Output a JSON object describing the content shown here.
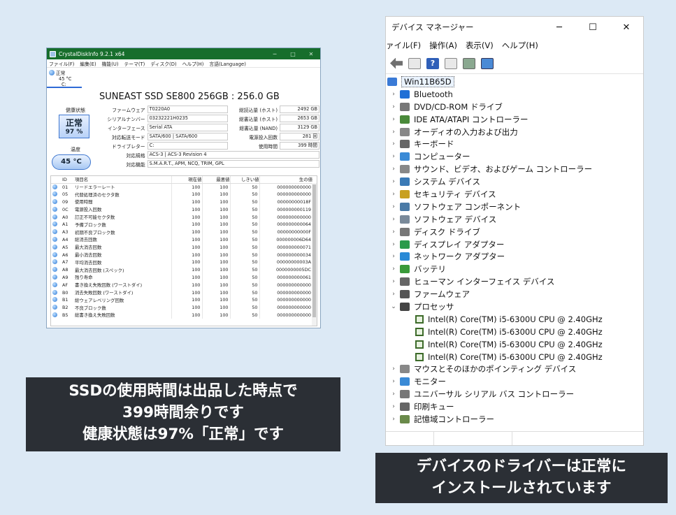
{
  "cdi": {
    "title": "CrystalDiskInfo 9.2.1 x64",
    "menu": [
      "ファイル(F)",
      "編集(E)",
      "機能(U)",
      "テーマ(T)",
      "ディスク(D)",
      "ヘルプ(H)",
      "言語(Language)"
    ],
    "disk_tab": {
      "status": "正常",
      "temp": "45 °C",
      "drive": "C:"
    },
    "disk_name": "SUNEAST SSD SE800 256GB : 256.0 GB",
    "health_label": "健康状態",
    "health_status": "正常",
    "health_percent": "97 %",
    "temp_label": "温度",
    "temp_value": "45 °C",
    "info_left": [
      {
        "label": "ファームウェア",
        "value": "T0220A0"
      },
      {
        "label": "シリアルナンバー",
        "value": "03232221H0235"
      },
      {
        "label": "インターフェース",
        "value": "Serial ATA"
      },
      {
        "label": "対応転送モード",
        "value": "SATA/600 | SATA/600"
      },
      {
        "label": "ドライブレター",
        "value": "C:"
      }
    ],
    "info_right": [
      {
        "label": "総読込量 (ホスト)",
        "value": "2492 GB"
      },
      {
        "label": "総書込量 (ホスト)",
        "value": "2653 GB"
      },
      {
        "label": "総書込量 (NAND)",
        "value": "3129 GB"
      },
      {
        "label": "電源投入回数",
        "value": "281 回"
      },
      {
        "label": "使用時間",
        "value": "399 時間"
      }
    ],
    "standard_label": "対応規格",
    "standard_value": "ACS-3 | ACS-3 Revision 4",
    "features_label": "対応機能",
    "features_value": "S.M.A.R.T., APM, NCQ, TRIM, GPL",
    "smart_headers": [
      "ID",
      "項目名",
      "現在値",
      "最悪値",
      "しきい値",
      "生の値"
    ],
    "smart_rows": [
      [
        "01",
        "リードエラーレート",
        "100",
        "100",
        "50",
        "000000000000"
      ],
      [
        "05",
        "代替処理済のセクタ数",
        "100",
        "100",
        "50",
        "000000000000"
      ],
      [
        "09",
        "使用時間",
        "100",
        "100",
        "50",
        "00000000018F"
      ],
      [
        "0C",
        "電源投入回数",
        "100",
        "100",
        "50",
        "000000000119"
      ],
      [
        "A0",
        "訂正不可能セクタ数",
        "100",
        "100",
        "50",
        "000000000000"
      ],
      [
        "A1",
        "予備ブロック数",
        "100",
        "100",
        "50",
        "000000000064"
      ],
      [
        "A3",
        "初期不良ブロック数",
        "100",
        "100",
        "50",
        "00000000000F"
      ],
      [
        "A4",
        "総消去回数",
        "100",
        "100",
        "50",
        "000000006D64"
      ],
      [
        "A5",
        "最大消去回数",
        "100",
        "100",
        "50",
        "000000000071"
      ],
      [
        "A6",
        "最小消去回数",
        "100",
        "100",
        "50",
        "000000000034"
      ],
      [
        "A7",
        "平均消去回数",
        "100",
        "100",
        "50",
        "00000000003A"
      ],
      [
        "A8",
        "最大消去回数 (スペック)",
        "100",
        "100",
        "50",
        "0000000005DC"
      ],
      [
        "A9",
        "残り寿命",
        "100",
        "100",
        "50",
        "000000000061"
      ],
      [
        "AF",
        "書き換え失敗回数 (ワーストダイ)",
        "100",
        "100",
        "50",
        "000000000000"
      ],
      [
        "B0",
        "消去失敗回数 (ワーストダイ)",
        "100",
        "100",
        "50",
        "000000000000"
      ],
      [
        "B1",
        "総ウェアレベリング回数",
        "100",
        "100",
        "50",
        "000000000000"
      ],
      [
        "B2",
        "不良ブロック数",
        "100",
        "100",
        "50",
        "000000000000"
      ],
      [
        "B5",
        "総書き換え失敗回数",
        "100",
        "100",
        "50",
        "000000000000"
      ]
    ]
  },
  "dm": {
    "title": "デバイス マネージャー",
    "menu": [
      "ァイル(F)",
      "操作(A)",
      "表示(V)",
      "ヘルプ(H)"
    ],
    "root": "Win11B65D",
    "categories": [
      {
        "label": "Bluetooth",
        "color": "#1f6fd6"
      },
      {
        "label": "DVD/CD-ROM ドライブ",
        "color": "#777777"
      },
      {
        "label": "IDE ATA/ATAPI コントローラー",
        "color": "#4a8a3a"
      },
      {
        "label": "オーディオの入力および出力",
        "color": "#888888"
      },
      {
        "label": "キーボード",
        "color": "#666666"
      },
      {
        "label": "コンピューター",
        "color": "#3a8ad6"
      },
      {
        "label": "サウンド、ビデオ、およびゲーム コントローラー",
        "color": "#888888"
      },
      {
        "label": "システム デバイス",
        "color": "#3a7ab6"
      },
      {
        "label": "セキュリティ デバイス",
        "color": "#c8a020"
      },
      {
        "label": "ソフトウェア コンポーネント",
        "color": "#4a7aa6"
      },
      {
        "label": "ソフトウェア デバイス",
        "color": "#7a8a9a"
      },
      {
        "label": "ディスク ドライブ",
        "color": "#777777"
      },
      {
        "label": "ディスプレイ アダプター",
        "color": "#2a9a4a"
      },
      {
        "label": "ネットワーク アダプター",
        "color": "#2a8ad6"
      },
      {
        "label": "バッテリ",
        "color": "#3a9a3a"
      },
      {
        "label": "ヒューマン インターフェイス デバイス",
        "color": "#666666"
      },
      {
        "label": "ファームウェア",
        "color": "#555555"
      }
    ],
    "processor_label": "プロセッサ",
    "processors": [
      "Intel(R) Core(TM) i5-6300U CPU @ 2.40GHz",
      "Intel(R) Core(TM) i5-6300U CPU @ 2.40GHz",
      "Intel(R) Core(TM) i5-6300U CPU @ 2.40GHz",
      "Intel(R) Core(TM) i5-6300U CPU @ 2.40GHz"
    ],
    "categories_after": [
      {
        "label": "マウスとそのほかのポインティング デバイス",
        "color": "#888888"
      },
      {
        "label": "モニター",
        "color": "#3a8ad6"
      },
      {
        "label": "ユニバーサル シリアル バス コントローラー",
        "color": "#777777"
      },
      {
        "label": "印刷キュー",
        "color": "#666666"
      },
      {
        "label": "記憶域コントローラー",
        "color": "#6a8a4a"
      }
    ]
  },
  "captions": {
    "left": [
      "SSDの使用時間は出品した時点で",
      "399時間余りです",
      "健康状態は97%「正常」です"
    ],
    "right": [
      "デバイスのドライバーは正常に",
      "インストールされています"
    ]
  }
}
